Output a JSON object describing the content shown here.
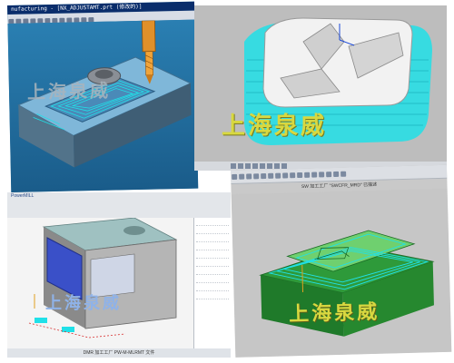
{
  "brand_text": "上海泉威",
  "panels": [
    {
      "id": "p1",
      "titlebar": "nufacturing - [NX_ADJUSTAMT.prt (修改的)]",
      "scene": "mold-base-with-end-mill"
    },
    {
      "id": "p2",
      "scene": "rounded-mold-insert"
    },
    {
      "id": "p3",
      "title": "PowerMILL",
      "status_text": "DMR 加工工厂 PW-M-MLRMT 文件",
      "scene": "machine-housing-with-window"
    },
    {
      "id": "p4",
      "window_title": "SW 加工工厂 \"SWCFR_MRD\" 已描述",
      "scene": "green-mold-core-toolpaths"
    }
  ],
  "colors": {
    "toolpath_cyan": "#20e0e8",
    "tool_orange": "#e0902a",
    "mold_green": "#2e9a3a",
    "brand_yellow": "#d8d840",
    "window_blue": "#3a50c8"
  }
}
